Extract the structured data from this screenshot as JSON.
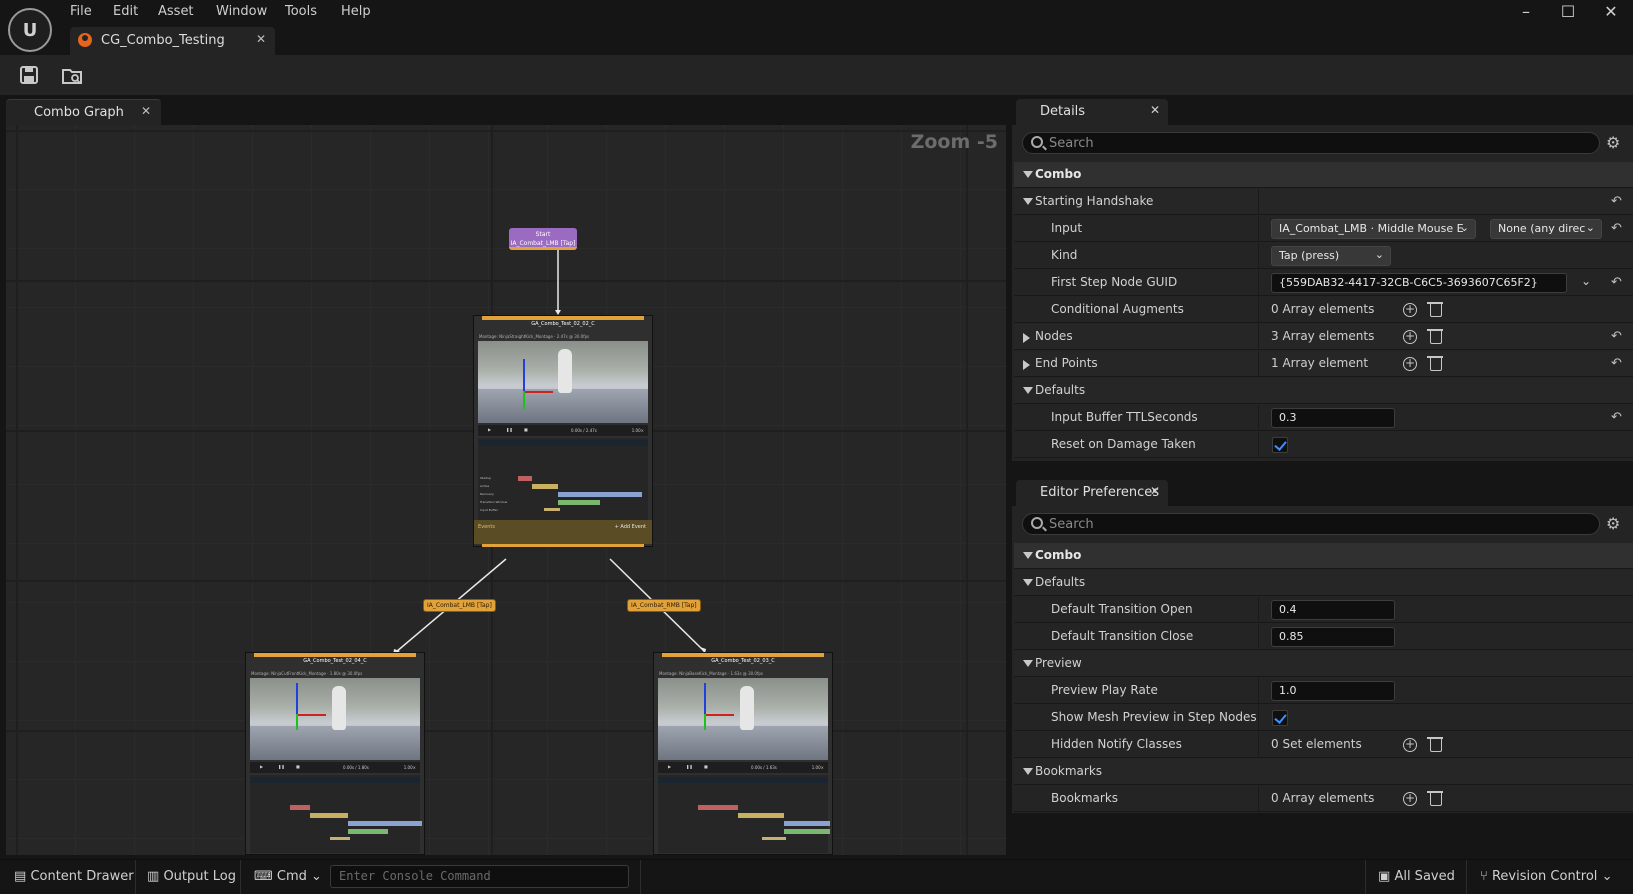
{
  "app": {
    "menu": [
      "File",
      "Edit",
      "Asset",
      "Window",
      "Tools",
      "Help"
    ],
    "asset_tab": "CG_Combo_Testing",
    "logo_icon": "unreal-logo-icon"
  },
  "graph": {
    "tab_label": "Combo Graph",
    "zoom": "Zoom -5",
    "start_node": {
      "title": "Start",
      "subtitle": "IA_Combat_LMB [Tap]"
    },
    "edges": [
      {
        "label": "IA_Combat_LMB [Tap]"
      },
      {
        "label": "IA_Combat_RMB [Tap]"
      }
    ],
    "nodes": [
      {
        "title": "GA_Combo_Test_02_02_C",
        "montage": "Montage: NinjaStraightKick_Montage · 2.47s @ 30.0fps",
        "time": "0.00s / 2.47s",
        "rate": "1.00×",
        "events_label": "Events",
        "add_event": "+ Add Event"
      },
      {
        "title": "GA_Combo_Test_02_04_C",
        "montage": "Montage: NinjaCutFrontKick_Montage · 1.80s @ 30.0fps",
        "time": "0.00s / 1.80s",
        "rate": "1.00×"
      },
      {
        "title": "GA_Combo_Test_02_03_C",
        "montage": "Montage: NinjaBaseKick_Montage · 1.63s @ 30.0fps",
        "time": "0.00s / 1.63s",
        "rate": "1.00×"
      }
    ],
    "timeline_rows": [
      "Startup",
      "Active",
      "Recovery",
      "Transition Window",
      "Input Buffer"
    ]
  },
  "details": {
    "tab_label": "Details",
    "search_placeholder": "Search",
    "combo_label": "Combo",
    "starting_handshake": "Starting Handshake",
    "input_label": "Input",
    "input_value": "IA_Combat_LMB · Middle Mouse E",
    "input_direction": "None (any direc",
    "kind_label": "Kind",
    "kind_value": "Tap (press)",
    "guid_label": "First Step Node GUID",
    "guid_value": "{559DAB32-4417-32CB-C6C5-3693607C65F2}",
    "cond_label": "Conditional Augments",
    "cond_value": "0 Array elements",
    "nodes_label": "Nodes",
    "nodes_value": "3 Array elements",
    "endpoints_label": "End Points",
    "endpoints_value": "1 Array element",
    "defaults_label": "Defaults",
    "buffer_label": "Input Buffer TTLSeconds",
    "buffer_value": "0.3",
    "reset_label": "Reset on Damage Taken",
    "reset_checked": true
  },
  "prefs": {
    "tab_label": "Editor Preferences",
    "search_placeholder": "Search",
    "combo_label": "Combo",
    "defaults_label": "Defaults",
    "open_label": "Default Transition Open",
    "open_value": "0.4",
    "close_label": "Default Transition Close",
    "close_value": "0.85",
    "preview_label": "Preview",
    "rate_label": "Preview Play Rate",
    "rate_value": "1.0",
    "mesh_label": "Show Mesh Preview in Step Nodes",
    "mesh_checked": true,
    "hidden_label": "Hidden Notify Classes",
    "hidden_value": "0 Set elements",
    "bookmarks_cat": "Bookmarks",
    "bookmarks_label": "Bookmarks",
    "bookmarks_value": "0 Array elements"
  },
  "statusbar": {
    "content_drawer": "Content Drawer",
    "output_log": "Output Log",
    "cmd": "Cmd",
    "console_placeholder": "Enter Console Command",
    "saved": "All Saved",
    "revision": "Revision Control"
  },
  "colors": {
    "accent": "#e2a23a",
    "start_node": "#9a6bc1",
    "check": "#3b8fff"
  }
}
